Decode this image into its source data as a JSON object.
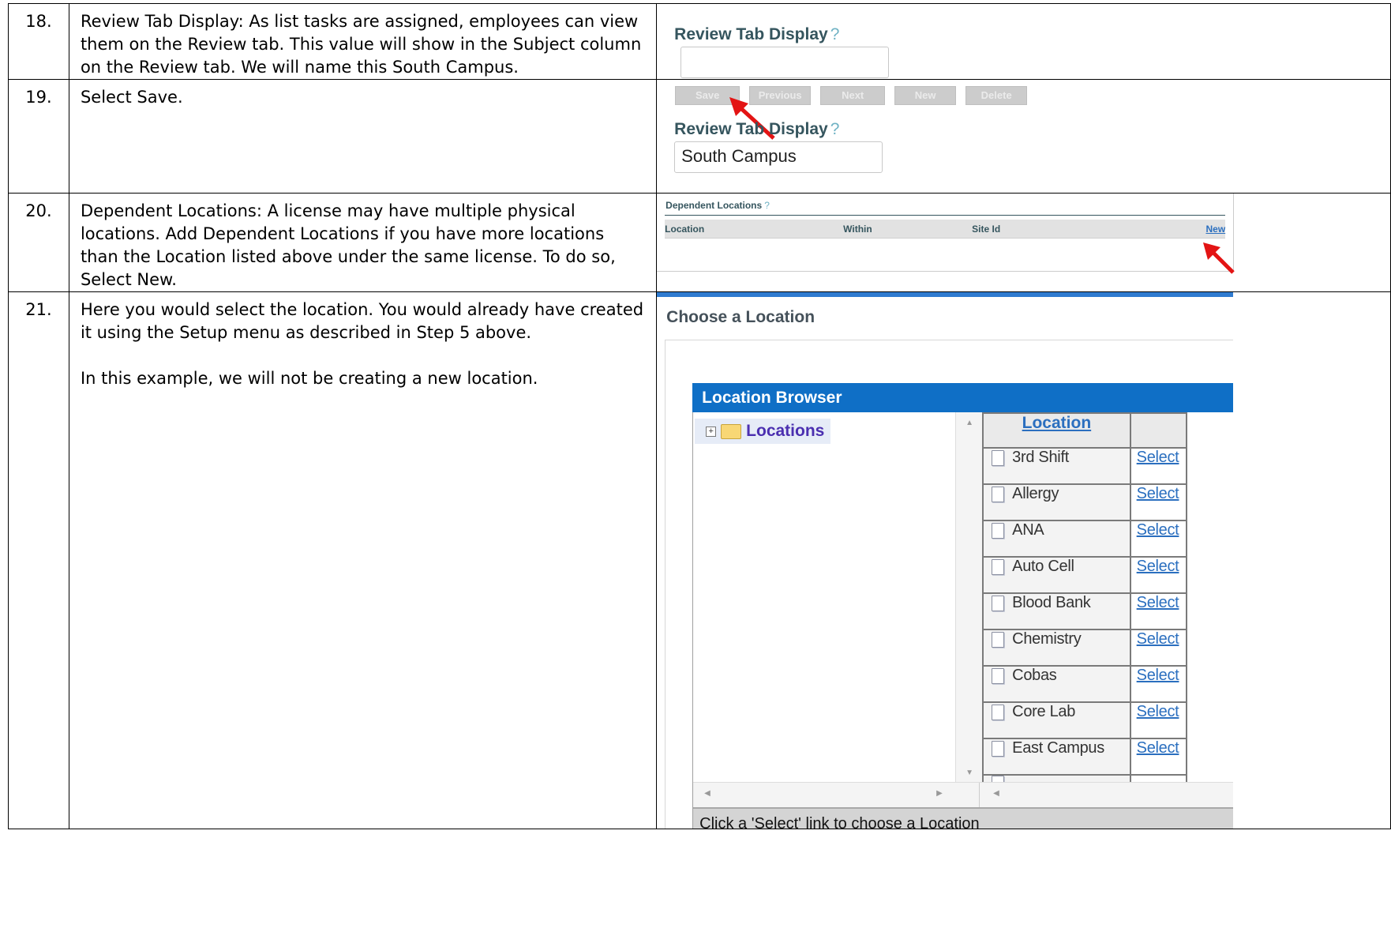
{
  "rows": [
    {
      "num": "18.",
      "desc": "Review Tab Display:  As list tasks are assigned, employees can view them on the Review tab.  This value will show in the Subject column on the Review tab.  We will name this South Campus.",
      "field_label": "Review Tab Display",
      "help": "?",
      "value": ""
    },
    {
      "num": "19.",
      "desc": "Select Save.",
      "buttons": [
        "Save",
        "Previous",
        "Next",
        "New",
        "Delete"
      ],
      "field_label": "Review Tab Display",
      "help": "?",
      "value": "South Campus"
    },
    {
      "num": "20.",
      "desc": "Dependent Locations:  A license may have multiple physical locations.  Add Dependent Locations if you have  more locations than the Location listed above under the same license.  To do so, Select New.",
      "section_title": "Dependent Locations",
      "help": "?",
      "columns": [
        "Location",
        "Within",
        "Site Id"
      ],
      "new_link": "New"
    },
    {
      "num": "21.",
      "desc_1": "Here you would select the location.  You would already have created it using the Setup menu as described  in Step 5 above.",
      "desc_2": "In this example, we will not be creating a new location.",
      "modal_title": "Choose a Location",
      "browser_title": "Location Browser",
      "tree_root": "Locations",
      "grid_header": "Location",
      "select_label": "Select",
      "locations": [
        "3rd Shift",
        "Allergy",
        "ANA",
        "Auto Cell",
        "Blood Bank",
        "Chemistry",
        "Cobas",
        "Core Lab",
        "East Campus"
      ],
      "status": "Click a 'Select' link to choose a Location"
    }
  ],
  "colors": {
    "arrow": "#e31414",
    "header_blue": "#0f6fc6",
    "link": "#2b6fbf",
    "label": "#35555e"
  }
}
